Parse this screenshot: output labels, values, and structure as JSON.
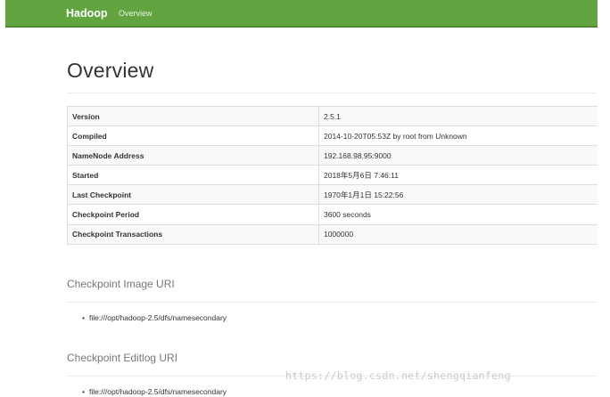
{
  "navbar": {
    "brand": "Hadoop",
    "links": [
      "Overview"
    ],
    "color": "#62a43f"
  },
  "main": {
    "title": "Overview",
    "info_rows": [
      {
        "key": "Version",
        "value": "2.5.1"
      },
      {
        "key": "Compiled",
        "value": "2014-10-20T05:53Z by root from Unknown"
      },
      {
        "key": "NameNode Address",
        "value": "192.168.98.95:9000"
      },
      {
        "key": "Started",
        "value": "2018年5月6日 7:46:11"
      },
      {
        "key": "Last Checkpoint",
        "value": "1970年1月1日 15:22:56"
      },
      {
        "key": "Checkpoint Period",
        "value": "3600 seconds"
      },
      {
        "key": "Checkpoint Transactions",
        "value": "1000000"
      }
    ],
    "checkpoint_image": {
      "heading": "Checkpoint Image URI",
      "items": [
        "file:///opt/hadoop-2.5/dfs/namesecondary"
      ]
    },
    "checkpoint_editlog": {
      "heading": "Checkpoint Editlog URI",
      "items": [
        "file:///opt/hadoop-2.5/dfs/namesecondary"
      ]
    }
  },
  "watermark": "https://blog.csdn.net/shengqianfeng"
}
